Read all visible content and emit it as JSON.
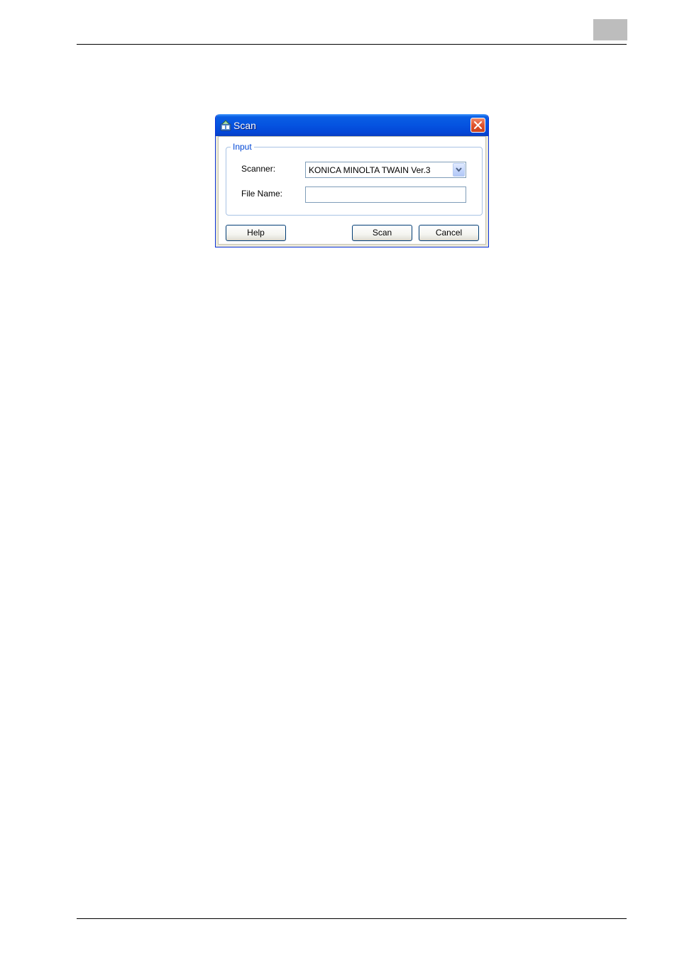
{
  "dialog": {
    "title": "Scan",
    "icon": "scan-app-icon",
    "close_icon": "close-icon",
    "group": {
      "legend": "Input",
      "scanner_label": "Scanner:",
      "scanner_value": "KONICA MINOLTA TWAIN Ver.3",
      "dropdown_icon": "chevron-down-icon",
      "filename_label": "File Name:",
      "filename_value": ""
    },
    "buttons": {
      "help": "Help",
      "scan": "Scan",
      "cancel": "Cancel"
    }
  },
  "colors": {
    "titlebar": "#0553e0",
    "close_button": "#e0542e",
    "group_legend": "#0046d5",
    "page_tab": "#bdbdbd"
  }
}
